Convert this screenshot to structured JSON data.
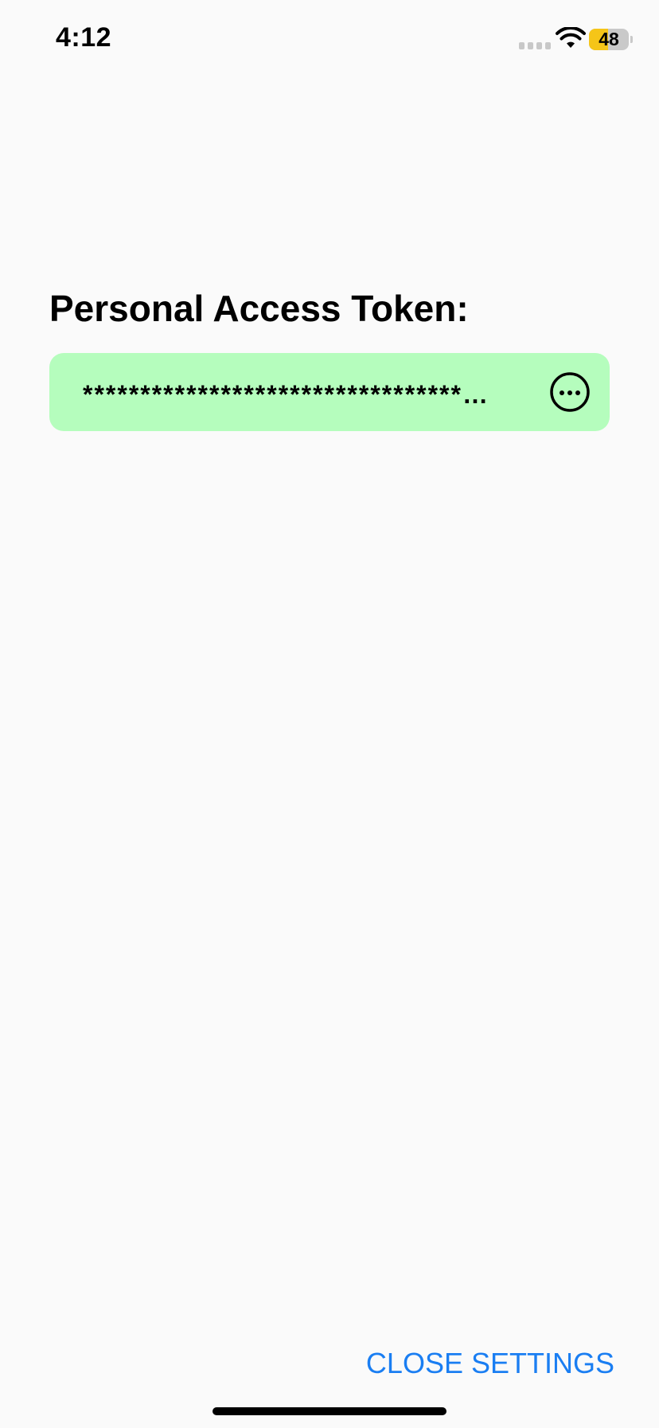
{
  "status_bar": {
    "time": "4:12",
    "battery_level": "48",
    "battery_fraction": 0.48,
    "battery_color": "#f5c518"
  },
  "settings": {
    "title": "Personal Access Token:",
    "token_value": "******************************************",
    "token_field_color": "#b5fdbd",
    "more_icon": "ellipsis-circle-icon"
  },
  "footer": {
    "close_label": "CLOSE SETTINGS",
    "accent_color": "#1a7ef2"
  }
}
